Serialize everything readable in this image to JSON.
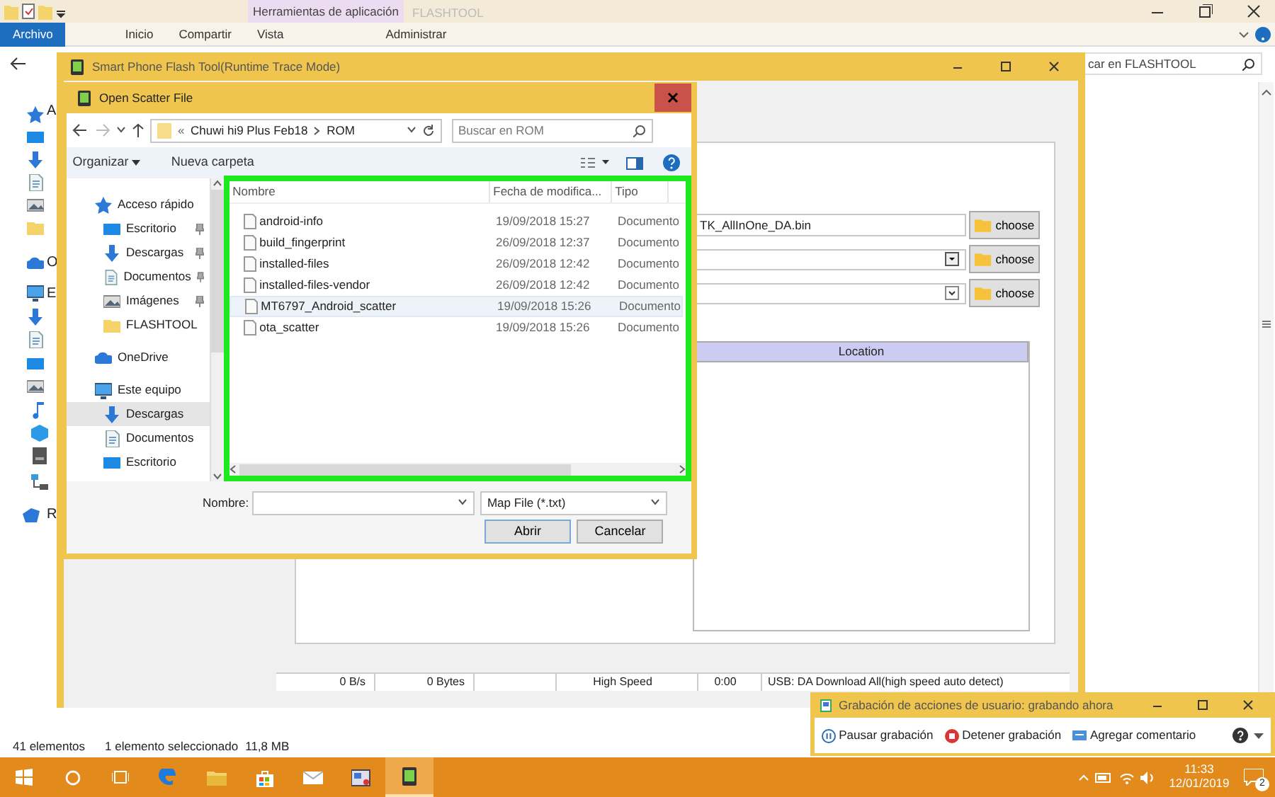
{
  "explorer": {
    "context_tab": "Herramientas de aplicación",
    "title": "FLASHTOOL",
    "ribbon_tabs": [
      {
        "label": "Archivo",
        "selected": true
      },
      {
        "label": "Inicio",
        "selected": false
      },
      {
        "label": "Compartir",
        "selected": false
      },
      {
        "label": "Vista",
        "selected": false
      },
      {
        "label": "Administrar",
        "selected": false
      }
    ],
    "search_placeholder": "car en FLASHTOOL",
    "nav_letters": [
      "A",
      "O",
      "E",
      "R"
    ],
    "status": [
      "41 elementos",
      "1 elemento seleccionado",
      "11,8 MB"
    ]
  },
  "flashtool": {
    "title": "Smart Phone Flash Tool(Runtime Trace Mode)",
    "da_file": "TK_AllInOne_DA.bin",
    "choose_buttons": [
      "choose",
      "choose",
      "choose"
    ],
    "table_columns": [
      "Location"
    ],
    "status_cells": [
      "0 B/s",
      "0 Bytes",
      "High Speed",
      "0:00",
      "USB: DA Download All(high speed auto detect)"
    ]
  },
  "dialog": {
    "title": "Open Scatter File",
    "breadcrumb_overflow": "«",
    "breadcrumb": [
      "Chuwi hi9 Plus Feb18",
      "ROM"
    ],
    "search_placeholder": "Buscar en ROM",
    "toolbar": [
      "Organizar",
      "Nueva carpeta"
    ],
    "nav": [
      {
        "label": "Acceso rápido",
        "kind": "star",
        "selected": false,
        "children": [
          {
            "label": "Escritorio",
            "kind": "desktop",
            "pinned": true,
            "selected": false
          },
          {
            "label": "Descargas",
            "kind": "download",
            "pinned": true,
            "selected": false
          },
          {
            "label": "Documentos",
            "kind": "document",
            "pinned": true,
            "selected": false
          },
          {
            "label": "Imágenes",
            "kind": "image",
            "pinned": true,
            "selected": false
          },
          {
            "label": "FLASHTOOL",
            "kind": "folder",
            "pinned": false,
            "selected": false
          }
        ]
      },
      {
        "label": "OneDrive",
        "kind": "cloud",
        "selected": false
      },
      {
        "label": "Este equipo",
        "kind": "computer",
        "selected": false,
        "children": [
          {
            "label": "Descargas",
            "kind": "download",
            "pinned": false,
            "selected": true
          },
          {
            "label": "Documentos",
            "kind": "document",
            "pinned": false,
            "selected": false
          },
          {
            "label": "Escritorio",
            "kind": "desktop",
            "pinned": false,
            "selected": false
          }
        ]
      }
    ],
    "columns": [
      "Nombre",
      "Fecha de modifica...",
      "Tipo"
    ],
    "files": [
      {
        "name": "android-info",
        "date": "19/09/2018 15:27",
        "type": "Documento",
        "hovered": false
      },
      {
        "name": "build_fingerprint",
        "date": "26/09/2018 12:37",
        "type": "Documento",
        "hovered": false
      },
      {
        "name": "installed-files",
        "date": "26/09/2018 12:42",
        "type": "Documento",
        "hovered": false
      },
      {
        "name": "installed-files-vendor",
        "date": "26/09/2018 12:42",
        "type": "Documento",
        "hovered": false
      },
      {
        "name": "MT6797_Android_scatter",
        "date": "19/09/2018 15:26",
        "type": "Documento",
        "hovered": true
      },
      {
        "name": "ota_scatter",
        "date": "19/09/2018 15:26",
        "type": "Documento",
        "hovered": false
      }
    ],
    "filename_label": "Nombre:",
    "filter": "Map File (*.txt)",
    "buttons": [
      "Abrir",
      "Cancelar"
    ]
  },
  "recorder": {
    "title": "Grabación de acciones de usuario: grabando ahora",
    "actions": [
      {
        "label": "Pausar grabación",
        "kind": "pause"
      },
      {
        "label": "Detener grabación",
        "kind": "stop"
      },
      {
        "label": "Agregar comentario",
        "kind": "comment"
      }
    ]
  },
  "taskbar": {
    "apps": [
      {
        "kind": "edge",
        "active": false
      },
      {
        "kind": "folder",
        "active": false
      },
      {
        "kind": "store",
        "active": false
      },
      {
        "kind": "mail",
        "active": false
      },
      {
        "kind": "app",
        "active": false
      },
      {
        "kind": "flash",
        "active": true
      }
    ],
    "time": "11:33",
    "date": "12/01/2019",
    "notifications": "2"
  }
}
